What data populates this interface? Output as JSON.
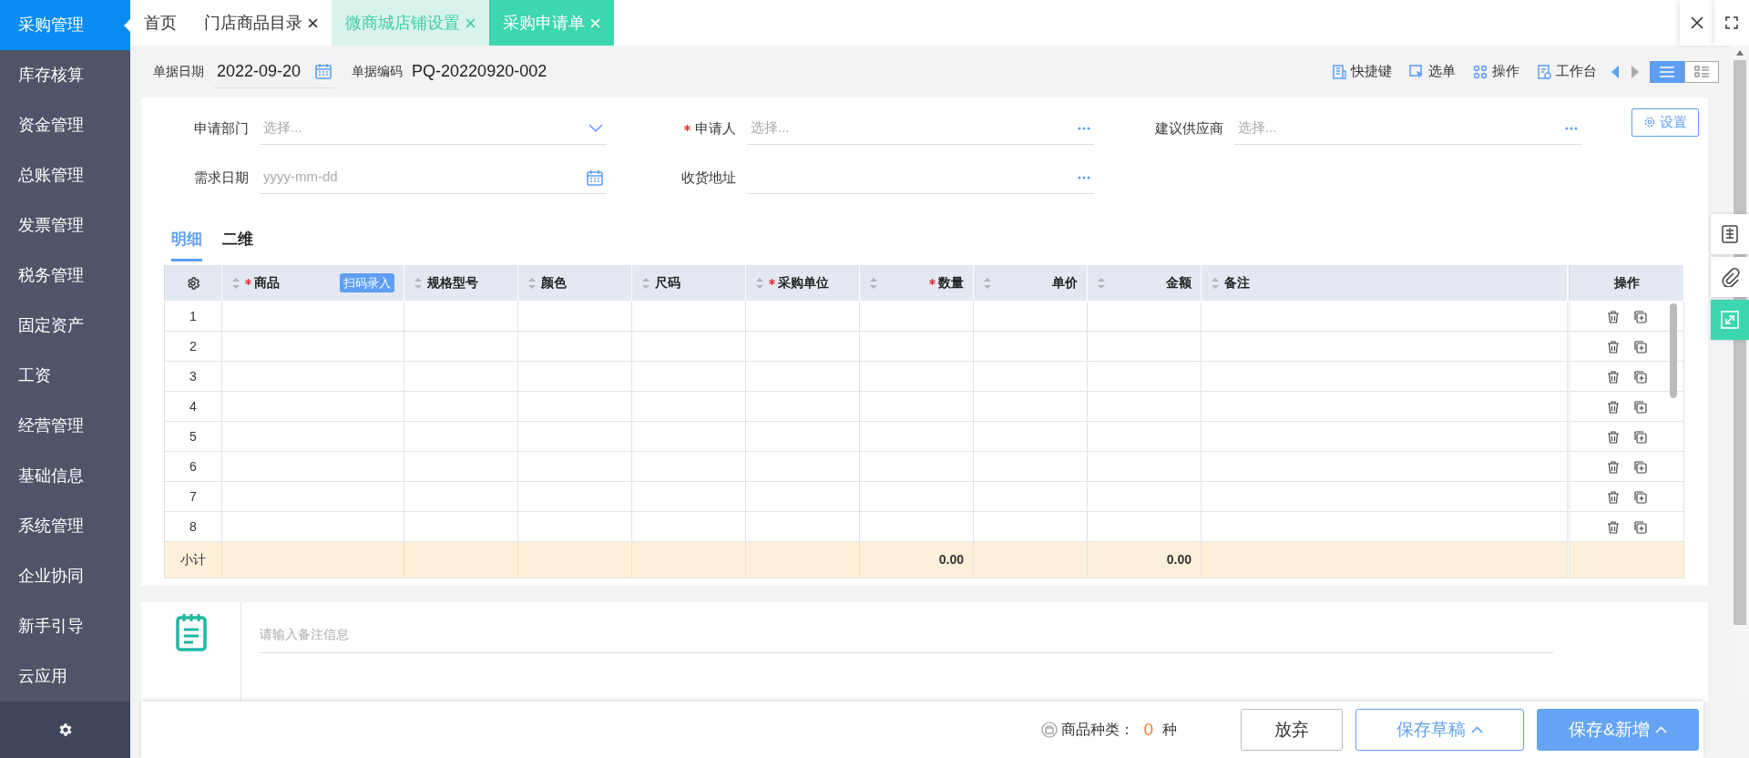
{
  "sidebar": {
    "items": [
      {
        "label": "采购管理",
        "selected": true
      },
      {
        "label": "库存核算",
        "selected": false
      },
      {
        "label": "资金管理",
        "selected": false
      },
      {
        "label": "总账管理",
        "selected": false
      },
      {
        "label": "发票管理",
        "selected": false
      },
      {
        "label": "税务管理",
        "selected": false
      },
      {
        "label": "固定资产",
        "selected": false
      },
      {
        "label": "工资",
        "selected": false
      },
      {
        "label": "经营管理",
        "selected": false
      },
      {
        "label": "基础信息",
        "selected": false
      },
      {
        "label": "系统管理",
        "selected": false
      },
      {
        "label": "企业协同",
        "selected": false
      },
      {
        "label": "新手引导",
        "selected": false
      },
      {
        "label": "云应用",
        "selected": false
      }
    ]
  },
  "tabs": [
    {
      "label": "首页",
      "selected": false,
      "hovered": false,
      "closable": false
    },
    {
      "label": "门店商品目录",
      "selected": false,
      "hovered": false,
      "closable": true
    },
    {
      "label": "微商城店铺设置",
      "selected": false,
      "hovered": true,
      "closable": true
    },
    {
      "label": "采购申请单",
      "selected": true,
      "hovered": false,
      "closable": true
    }
  ],
  "header": {
    "date_label": "单据日期",
    "date_value": "2022-09-20",
    "code_label": "单据编码",
    "code_value": "PQ-20220920-002",
    "toolbar": [
      {
        "kind": "shortcut",
        "label": "快捷键"
      },
      {
        "kind": "pick",
        "label": "选单"
      },
      {
        "kind": "ops",
        "label": "操作"
      },
      {
        "kind": "desk",
        "label": "工作台"
      }
    ],
    "view_modes": [
      {
        "kind": "list",
        "selected": true
      },
      {
        "kind": "detail",
        "selected": false
      }
    ]
  },
  "form": {
    "fields": [
      {
        "label": "申请部门",
        "required": false,
        "kind": "select",
        "placeholder": "选择..."
      },
      {
        "label": "申请人",
        "required": true,
        "kind": "lookup",
        "placeholder": "选择..."
      },
      {
        "label": "建议供应商",
        "required": false,
        "kind": "lookup",
        "placeholder": "选择..."
      },
      {
        "label": "需求日期",
        "required": false,
        "kind": "date",
        "placeholder": "yyyy-mm-dd"
      },
      {
        "label": "收货地址",
        "required": false,
        "kind": "lookup"
      }
    ],
    "settings_button": "设置"
  },
  "detail_tabs": [
    {
      "label": "明细",
      "selected": true
    },
    {
      "label": "二维",
      "selected": false
    }
  ],
  "table": {
    "columns": [
      {
        "label": "商品",
        "required": true,
        "kind": "text",
        "badge": "扫码录入"
      },
      {
        "label": "规格型号",
        "required": false,
        "kind": "text"
      },
      {
        "label": "颜色",
        "required": false,
        "kind": "text"
      },
      {
        "label": "尺码",
        "required": false,
        "kind": "text"
      },
      {
        "label": "采购单位",
        "required": true,
        "kind": "text"
      },
      {
        "label": "数量",
        "required": true,
        "kind": "number"
      },
      {
        "label": "单价",
        "required": false,
        "kind": "number"
      },
      {
        "label": "金额",
        "required": false,
        "kind": "number"
      },
      {
        "label": "备注",
        "required": false,
        "kind": "text"
      }
    ],
    "actions_label": "操作",
    "rows": [
      "1",
      "2",
      "3",
      "4",
      "5",
      "6",
      "7",
      "8"
    ],
    "subtotal": {
      "label": "小计",
      "cells": {
        "5": "0.00",
        "7": "0.00"
      }
    }
  },
  "remarks": {
    "placeholder": "请输入备注信息"
  },
  "side_tools": [
    {
      "kind": "draft",
      "selected": false
    },
    {
      "kind": "attach",
      "selected": false
    },
    {
      "kind": "expand",
      "selected": true
    }
  ],
  "footer": {
    "count_label": "商品种类：",
    "count_value": "0",
    "count_unit": "种",
    "buttons": [
      {
        "label": "放弃",
        "kind": "plain",
        "caret": false
      },
      {
        "label": "保存草稿",
        "kind": "outline",
        "caret": true
      },
      {
        "label": "保存&新增",
        "kind": "primary",
        "caret": true
      }
    ]
  }
}
